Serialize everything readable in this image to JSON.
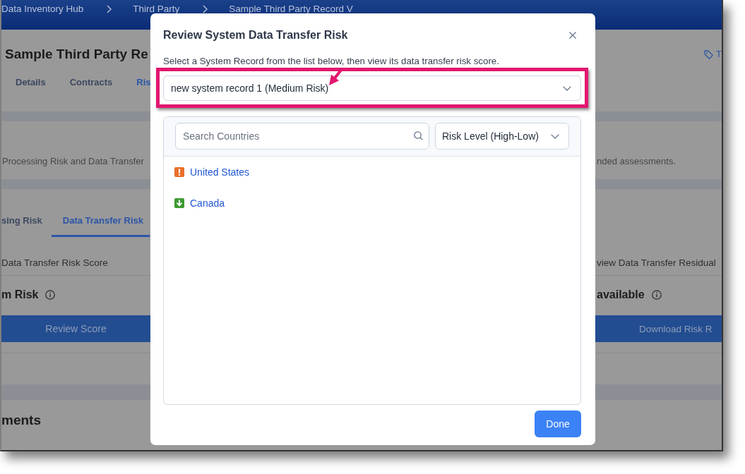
{
  "breadcrumbs": [
    "Data Inventory Hub",
    "Third Party",
    "Sample Third Party Record V"
  ],
  "page": {
    "title": "Sample Third Party Re",
    "tag_label": "T",
    "tabs": [
      {
        "label": "Details",
        "selected": false
      },
      {
        "label": "Contracts",
        "selected": false
      },
      {
        "label": "Ris",
        "selected": true
      }
    ],
    "intro_left": "Processing Risk and Data Transfer",
    "intro_right": "nded assessments.",
    "risk_tabs": [
      {
        "label": "sing Risk",
        "selected": false
      },
      {
        "label": "Data Transfer Risk",
        "selected": true
      }
    ],
    "score_panels": [
      {
        "heading": "Data Transfer Risk Score",
        "value": "m Risk",
        "button": "Review Score"
      },
      {
        "heading": "view Data Transfer Residual",
        "value": "available",
        "button": "Download Risk R"
      }
    ],
    "section_heading": "ments"
  },
  "dialog": {
    "title": "Review System Data Transfer Risk",
    "instructions": "Select a System Record from the list below, then view its data transfer risk score.",
    "system_record_select": {
      "value": "new system record 1 (Medium Risk)"
    },
    "search": {
      "placeholder": "Search Countries"
    },
    "sort_select": {
      "value": "Risk Level (High-Low)"
    },
    "countries": [
      {
        "name": "United States",
        "kind": "high"
      },
      {
        "name": "Canada",
        "kind": "low"
      }
    ],
    "buttons": [
      "Done"
    ]
  }
}
